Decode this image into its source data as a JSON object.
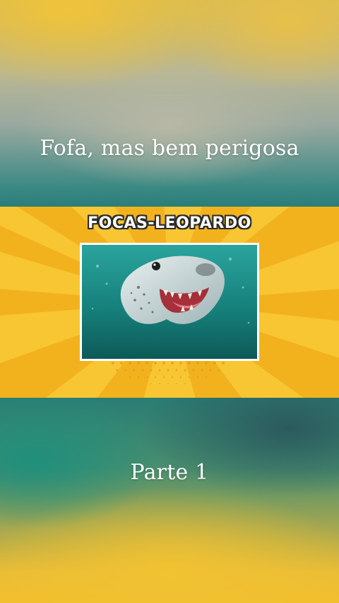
{
  "caption_top": "Fofa, mas bem perigosa",
  "banner": {
    "title": "FOCAS-LEOPARDO",
    "background_color": "#f7c632",
    "ray_color": "#f2b21e"
  },
  "photo": {
    "subject": "leopard-seal-underwater",
    "water_color": "#12706d"
  },
  "caption_bottom": "Parte 1"
}
